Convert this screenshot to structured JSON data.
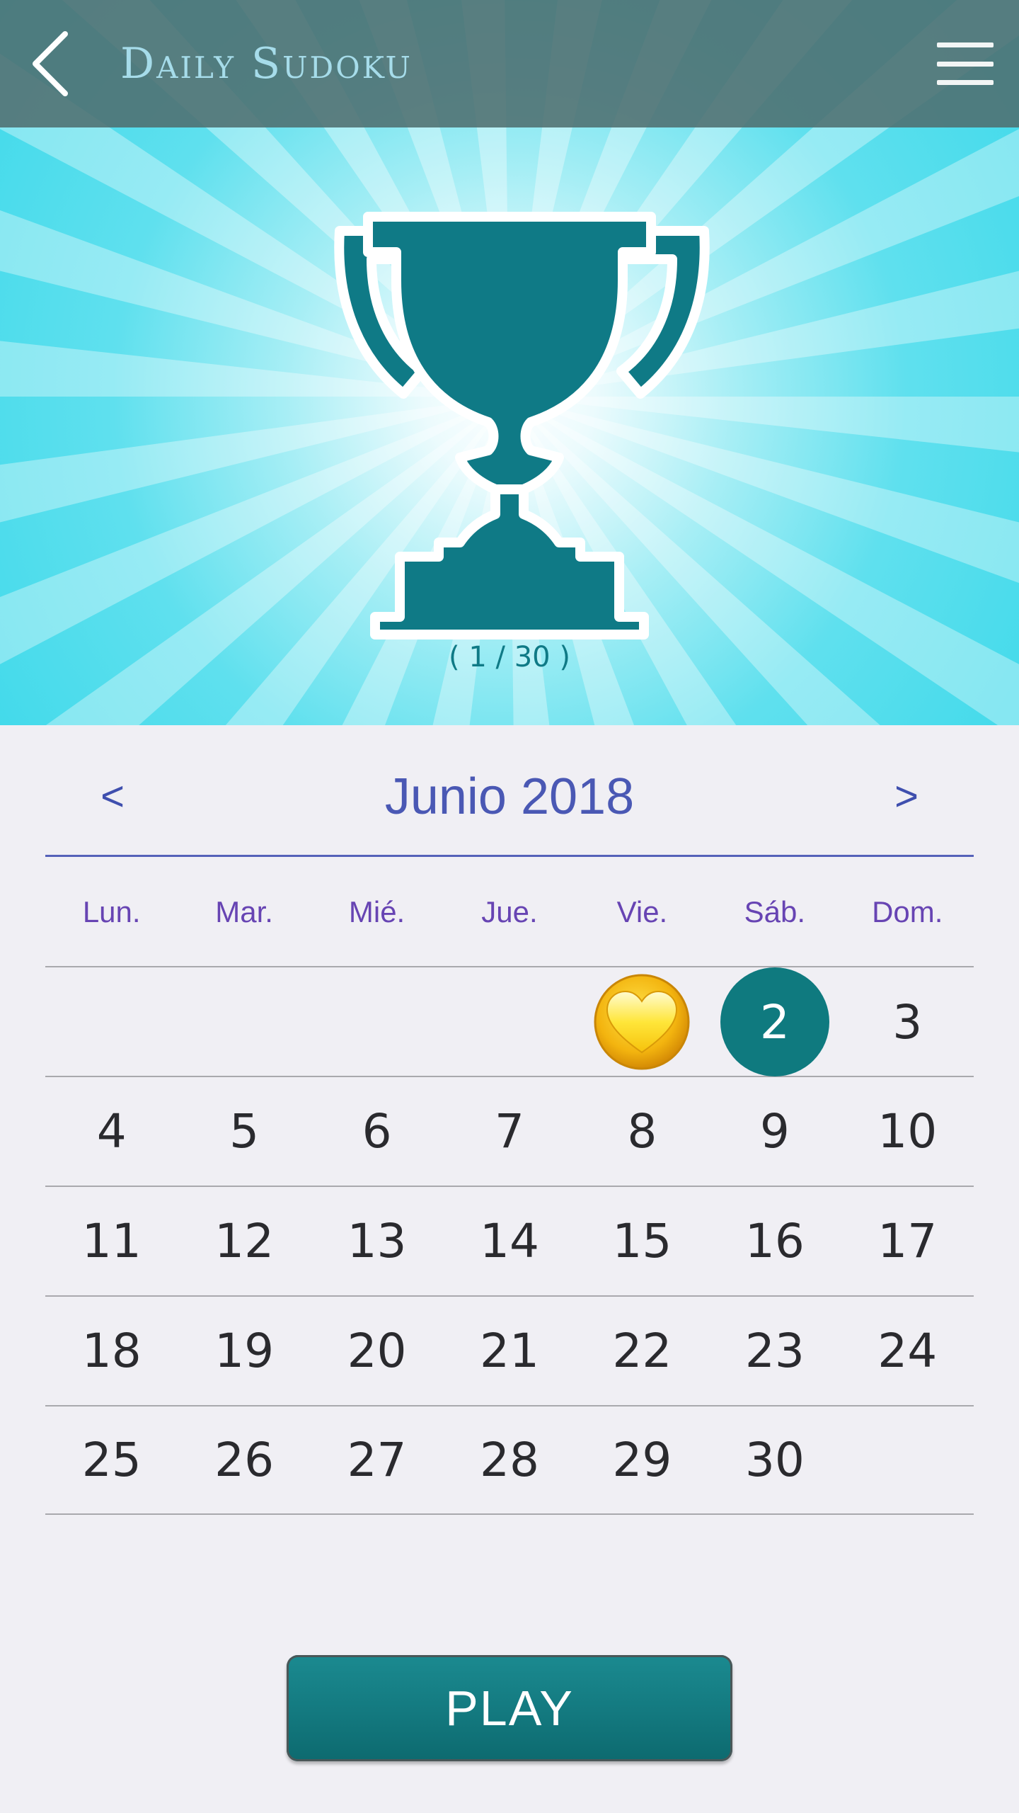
{
  "app_bar": {
    "title": "Daily Sudoku",
    "back_icon": "chevron-left-icon",
    "menu_icon": "hamburger-menu-icon"
  },
  "hero": {
    "trophy_icon": "trophy-icon",
    "progress_label": "( 1 / 30 )"
  },
  "calendar": {
    "month_title": "Junio 2018",
    "prev_label": "<",
    "next_label": ">",
    "weekdays": [
      "Lun.",
      "Mar.",
      "Mié.",
      "Jue.",
      "Vie.",
      "Sáb.",
      "Dom."
    ],
    "weeks": [
      [
        "",
        "",
        "",
        "",
        "",
        "2",
        "3"
      ],
      [
        "4",
        "5",
        "6",
        "7",
        "8",
        "9",
        "10"
      ],
      [
        "11",
        "12",
        "13",
        "14",
        "15",
        "16",
        "17"
      ],
      [
        "18",
        "19",
        "20",
        "21",
        "22",
        "23",
        "24"
      ],
      [
        "25",
        "26",
        "27",
        "28",
        "29",
        "30",
        ""
      ]
    ],
    "completed_day": "1",
    "completed_icon": "gold-heart-icon",
    "selected_day": "2"
  },
  "play_button": {
    "label": "PLAY"
  },
  "colors": {
    "app_bar": "#4e6e70",
    "title_text": "#a6dcea",
    "hero_sky": "#3fd9ea",
    "trophy": "#0f7a86",
    "month_text": "#4a58b4",
    "weekday_text": "#6744b3",
    "selected_circle": "#0f7a7f",
    "play_button": "#13797f"
  }
}
